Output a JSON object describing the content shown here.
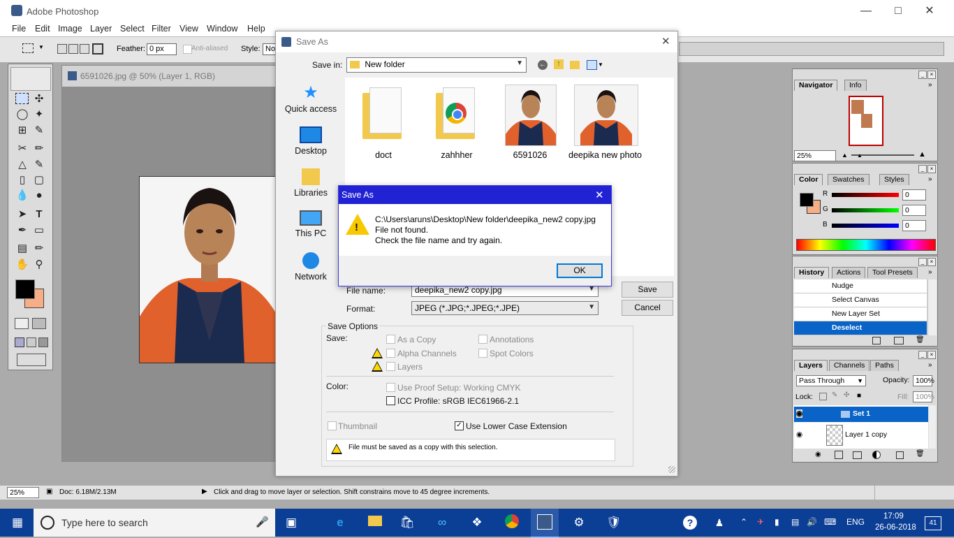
{
  "app": {
    "title": "Adobe Photoshop"
  },
  "menu": [
    "File",
    "Edit",
    "Image",
    "Layer",
    "Select",
    "Filter",
    "View",
    "Window",
    "Help"
  ],
  "options": {
    "feather_label": "Feather:",
    "feather_value": "0 px",
    "antialiased": "Anti-aliased",
    "style_label": "Style:",
    "style_value": "Nor"
  },
  "document": {
    "title": "6591026.jpg @ 50% (Layer 1, RGB)"
  },
  "save_dialog": {
    "title": "Save As",
    "save_in_label": "Save in:",
    "save_in_value": "New folder",
    "places": [
      "Quick access",
      "Desktop",
      "Libraries",
      "This PC",
      "Network"
    ],
    "files": [
      "doct",
      "zahhher",
      "6591026",
      "deepika new photo"
    ],
    "file_name_label": "File name:",
    "file_name_value": "deepika_new2 copy.jpg",
    "format_label": "Format:",
    "format_value": "JPEG (*.JPG;*.JPEG;*.JPE)",
    "save_button": "Save",
    "cancel_button": "Cancel",
    "options_group": "Save Options",
    "save_label": "Save:",
    "as_copy": "As a Copy",
    "annotations": "Annotations",
    "alpha_channels": "Alpha Channels",
    "spot_colors": "Spot Colors",
    "layers": "Layers",
    "color_label": "Color:",
    "use_proof": "Use Proof Setup:  Working CMYK",
    "icc_profile": "ICC Profile:  sRGB IEC61966-2.1",
    "thumbnail": "Thumbnail",
    "lowercase_ext": "Use Lower Case Extension",
    "warning_note": "File must be saved as a copy with this selection."
  },
  "error_dialog": {
    "title": "Save As",
    "line1": "C:\\Users\\aruns\\Desktop\\New folder\\deepika_new2 copy.jpg",
    "line2": "File not found.",
    "line3": "Check the file name and try again.",
    "ok": "OK"
  },
  "navigator": {
    "tabs": [
      "Navigator",
      "Info"
    ],
    "zoom": "25%"
  },
  "color_panel": {
    "tabs": [
      "Color",
      "Swatches",
      "Styles"
    ],
    "r": "0",
    "g": "0",
    "b": "0",
    "labels": [
      "R",
      "G",
      "B"
    ]
  },
  "history": {
    "tabs": [
      "History",
      "Actions",
      "Tool Presets"
    ],
    "items": [
      "Nudge",
      "Select Canvas",
      "New Layer Set",
      "Deselect"
    ]
  },
  "layers": {
    "tabs": [
      "Layers",
      "Channels",
      "Paths"
    ],
    "blend": "Pass Through",
    "opacity_label": "Opacity:",
    "opacity": "100%",
    "lock_label": "Lock:",
    "fill_label": "Fill:",
    "fill": "100%",
    "items": [
      "Set 1",
      "Layer 1 copy"
    ]
  },
  "statusbar": {
    "zoom": "25%",
    "doc": "Doc: 6.18M/2.13M",
    "hint": "Click and drag to move layer or selection. Shift constrains move to 45 degree increments."
  },
  "taskbar": {
    "search_placeholder": "Type here to search",
    "lang": "ENG",
    "time": "17:09",
    "date": "26-06-2018",
    "notifications": "41"
  },
  "colors": {
    "accent": "#0078d7",
    "dialog_title_blue": "#2222d5",
    "taskbar": "#0b3e95",
    "selection": "#0a64c8"
  }
}
